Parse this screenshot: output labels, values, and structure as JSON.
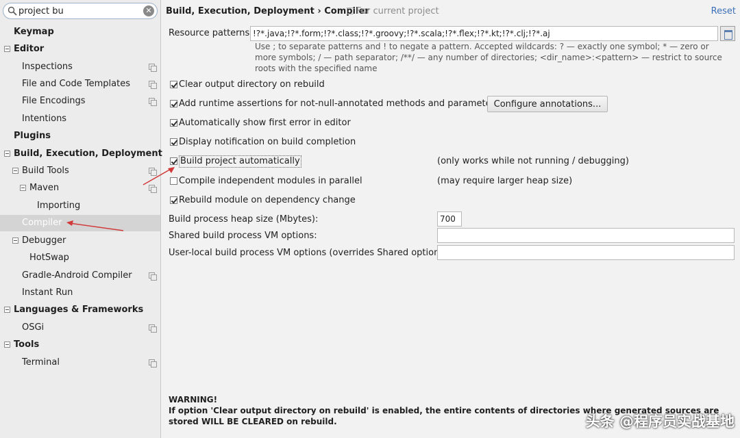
{
  "search": {
    "value": "project bu",
    "clear_icon": "clear-icon"
  },
  "sidebar": {
    "items": [
      {
        "label": "Keymap",
        "bold": true
      },
      {
        "label": "Editor",
        "bold": true,
        "expanded": true
      },
      {
        "label": "Inspections"
      },
      {
        "label": "File and Code Templates"
      },
      {
        "label": "File Encodings"
      },
      {
        "label": "Intentions"
      },
      {
        "label": "Plugins",
        "bold": true
      },
      {
        "label": "Build, Execution, Deployment",
        "bold": true,
        "expanded": true
      },
      {
        "label": "Build Tools",
        "expanded": true
      },
      {
        "label": "Maven",
        "expanded": true
      },
      {
        "label": "Importing"
      },
      {
        "label": "Compiler",
        "selected": true
      },
      {
        "label": "Debugger",
        "expanded": true
      },
      {
        "label": "HotSwap"
      },
      {
        "label": "Gradle-Android Compiler"
      },
      {
        "label": "Instant Run"
      },
      {
        "label": "Languages & Frameworks",
        "bold": true,
        "expanded": true
      },
      {
        "label": "OSGi"
      },
      {
        "label": "Tools",
        "bold": true,
        "expanded": true
      },
      {
        "label": "Terminal"
      }
    ]
  },
  "header": {
    "breadcrumb": "Build, Execution, Deployment › Compiler",
    "scope": "For current project",
    "reset": "Reset"
  },
  "form": {
    "resource_patterns_label": "Resource patterns:",
    "resource_patterns_value": "!?*.java;!?*.form;!?*.class;!?*.groovy;!?*.scala;!?*.flex;!?*.kt;!?*.clj;!?*.aj",
    "help_text": "Use ; to separate patterns and ! to negate a pattern. Accepted wildcards: ? — exactly one symbol; * — zero or more symbols; / — path separator; /**/ — any number of directories; <dir_name>:<pattern> — restrict to source roots with the specified name",
    "checkboxes": [
      {
        "label": "Clear output directory on rebuild",
        "checked": true
      },
      {
        "label": "Add runtime assertions for not-null-annotated methods and parameters",
        "checked": true
      },
      {
        "label": "Automatically show first error in editor",
        "checked": true
      },
      {
        "label": "Display notification on build completion",
        "checked": true
      },
      {
        "label": "Build project automatically",
        "checked": true,
        "note": "(only works while not running / debugging)"
      },
      {
        "label": "Compile independent modules in parallel",
        "checked": false,
        "note": "(may require larger heap size)"
      },
      {
        "label": "Rebuild module on dependency change",
        "checked": true
      }
    ],
    "configure_button": "Configure annotations...",
    "heap_label": "Build process heap size (Mbytes):",
    "heap_value": "700",
    "shared_vm_label": "Shared build process VM options:",
    "shared_vm_value": "",
    "local_vm_label": "User-local build process VM options (overrides Shared options):",
    "local_vm_value": ""
  },
  "warning": {
    "title": "WARNING!",
    "text": "If option 'Clear output directory on rebuild' is enabled, the entire contents of directories where generated sources are stored WILL BE CLEARED on rebuild."
  },
  "watermark": "头条 @程序员实战基地",
  "colors": {
    "link": "#3c70b8",
    "selected_bg": "#d4d4d4",
    "arrow": "#d23a3a"
  }
}
